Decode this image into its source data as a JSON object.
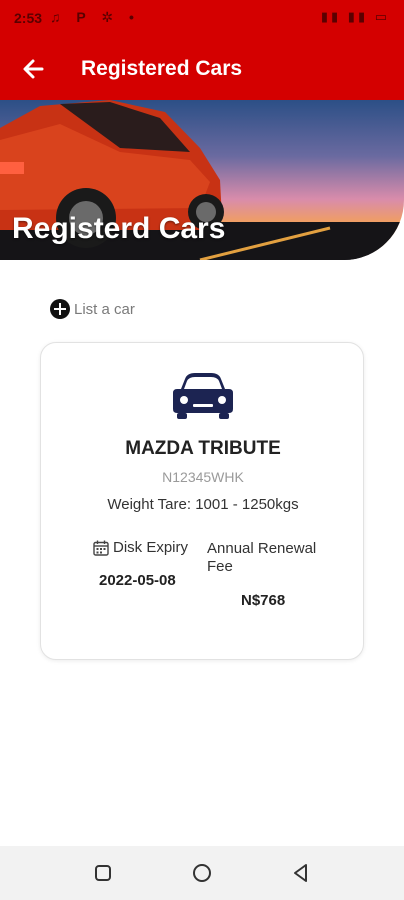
{
  "status_bar": {
    "time": "2:53",
    "left_icons": "♫ P ✲ •",
    "right_icons": "▮▮ ▮▮ ▭"
  },
  "app_bar": {
    "title": "Registered Cars"
  },
  "hero": {
    "title": "Registerd Cars"
  },
  "actions": {
    "list_car_label": "List a car"
  },
  "car": {
    "name": "MAZDA TRIBUTE",
    "plate": "N12345WHK",
    "weight": "Weight Tare: 1001 - 1250kgs",
    "disk_expiry_label": "Disk Expiry",
    "disk_expiry_value": "2022-05-08",
    "renewal_label": "Annual Renewal Fee",
    "renewal_value": "N$768"
  },
  "colors": {
    "brand": "#d40000",
    "car_icon": "#1c2452"
  },
  "icons": [
    "back-arrow-icon",
    "plus-circle-icon",
    "car-icon",
    "calendar-icon",
    "nav-recents-icon",
    "nav-home-icon",
    "nav-back-icon"
  ]
}
